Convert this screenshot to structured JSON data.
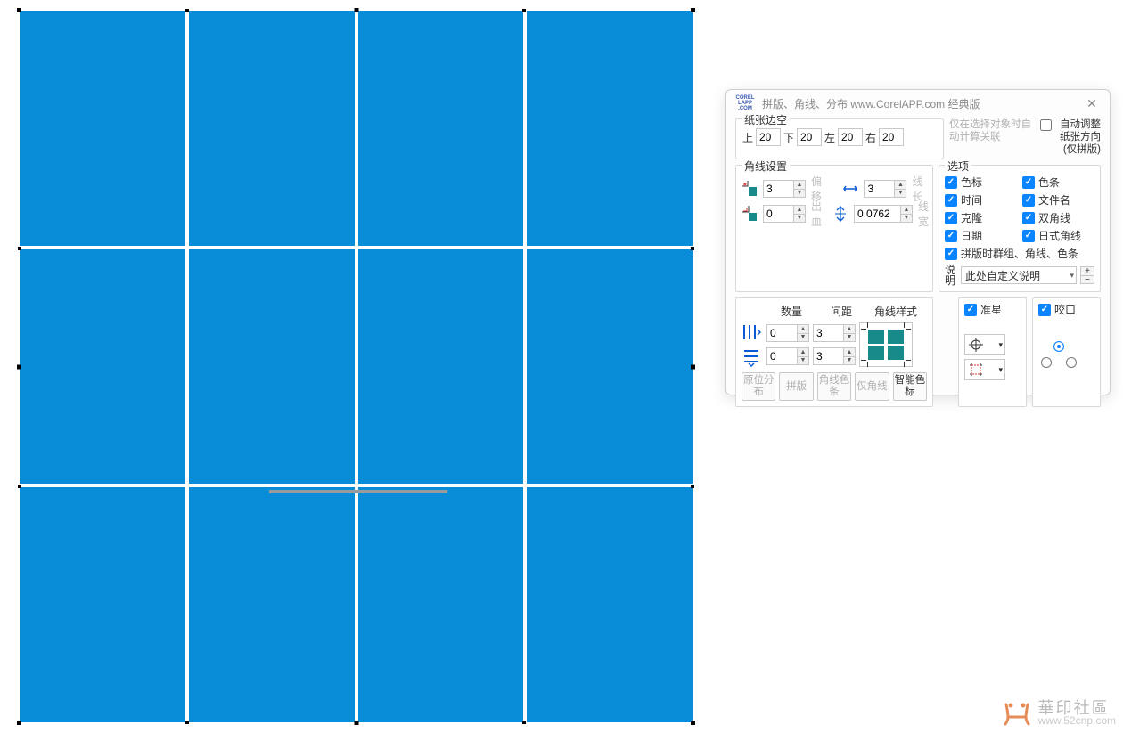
{
  "dialog": {
    "title": "拼版、角线、分布   www.CorelAPP.com 经典版",
    "margins": {
      "label": "纸张边空",
      "top_label": "上",
      "top": "20",
      "bottom_label": "下",
      "bottom": "20",
      "left_label": "左",
      "left": "20",
      "right_label": "右",
      "right": "20",
      "link_text": "仅在选择对象时自动计算关联",
      "auto_adjust": "自动调整纸张方向(仅拼版)"
    },
    "corner": {
      "label": "角线设置",
      "offset_label": "偏移",
      "offset": "3",
      "length_label": "线长",
      "length": "3",
      "bleed_label": "出血",
      "bleed": "0",
      "linewidth_label": "线宽",
      "linewidth": "0.0762"
    },
    "options": {
      "label": "选项",
      "color_mark": "色标",
      "color_bar": "色条",
      "time": "时间",
      "filename": "文件名",
      "clone": "克隆",
      "double_corner": "双角线",
      "date": "日期",
      "jp_corner": "日式角线",
      "group_all": "拼版时群组、角线、色条",
      "note_label": "说明",
      "note_value": "此处自定义说明"
    },
    "layout": {
      "qty_label": "数量",
      "gap_label": "间距",
      "style_label": "角线样式",
      "cols_qty": "0",
      "cols_gap": "3",
      "rows_qty": "0",
      "rows_gap": "3"
    },
    "buttons": {
      "dist": "原位分布",
      "impose": "拼版",
      "corner_bar": "角线色条",
      "corner_only": "仅角线",
      "smart": "智能色标"
    },
    "reg": {
      "label": "准星"
    },
    "bite": {
      "label": "咬口"
    }
  },
  "watermark": {
    "cn": "華印社區",
    "url": "www.52cnp.com"
  }
}
